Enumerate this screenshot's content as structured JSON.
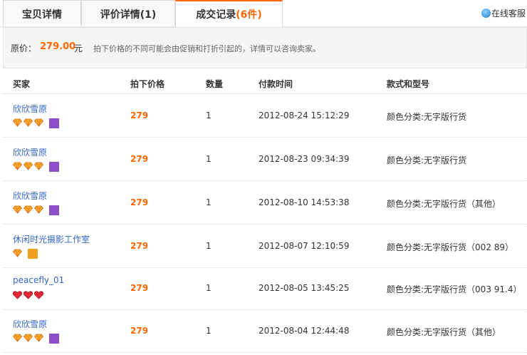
{
  "tabs": [
    {
      "label": "宝贝详情",
      "count": ""
    },
    {
      "label": "评价详情",
      "count": "(1)"
    },
    {
      "label": "成交记录",
      "count": "(6件)"
    }
  ],
  "service": {
    "label": "在线客服"
  },
  "price_bar": {
    "label": "原价：",
    "value": "279.00",
    "unit": "元",
    "note": "拍下价格的不同可能会由促销和打折引起的，详情可以咨询卖家。"
  },
  "table": {
    "headers": [
      "买家",
      "拍下价格",
      "数量",
      "付款时间",
      "款式和型号"
    ],
    "rows": [
      {
        "buyer": "欣欣雪原",
        "gem_type": "diamond",
        "gem_count": 3,
        "badge": "purple",
        "price": "279",
        "qty": "1",
        "time": "2012-08-24 15:12:29",
        "sku": "颜色分类:无字版行货"
      },
      {
        "buyer": "欣欣雪原",
        "gem_type": "diamond",
        "gem_count": 3,
        "badge": "purple",
        "price": "279",
        "qty": "1",
        "time": "2012-08-23 09:34:39",
        "sku": "颜色分类:无字版行货"
      },
      {
        "buyer": "欣欣雪原",
        "gem_type": "diamond",
        "gem_count": 3,
        "badge": "purple",
        "price": "279",
        "qty": "1",
        "time": "2012-08-10 14:53:38",
        "sku": "颜色分类:无字版行货（其他）"
      },
      {
        "buyer": "休闲时光摄影工作室",
        "gem_type": "diamond",
        "gem_count": 1,
        "badge": "orange",
        "price": "279",
        "qty": "1",
        "time": "2012-08-07 12:10:59",
        "sku": "颜色分类:无字版行货（002 89）"
      },
      {
        "buyer": "peacefly_01",
        "gem_type": "heart",
        "gem_count": 3,
        "badge": "",
        "price": "279",
        "qty": "1",
        "time": "2012-08-05 13:45:25",
        "sku": "颜色分类:无字版行货（003 91.4）"
      },
      {
        "buyer": "欣欣雪原",
        "gem_type": "diamond",
        "gem_count": 3,
        "badge": "purple",
        "price": "279",
        "qty": "1",
        "time": "2012-08-04 12:44:48",
        "sku": "颜色分类:无字版行货（其他）"
      }
    ]
  },
  "colors": {
    "accent": "#ff6600",
    "link": "#3366cc"
  }
}
